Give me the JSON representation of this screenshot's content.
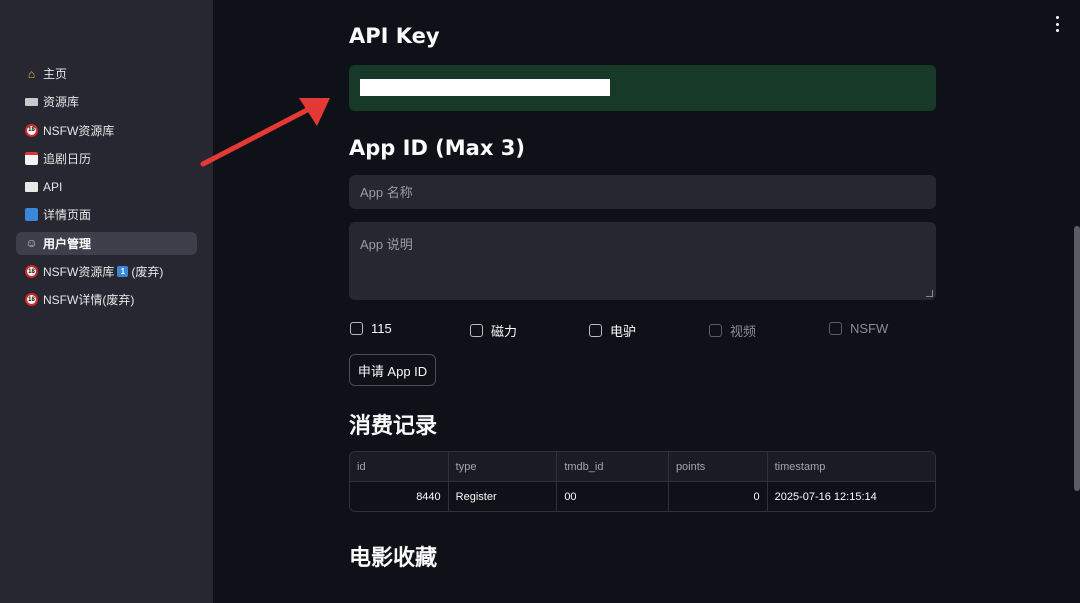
{
  "sidebar": {
    "items": [
      {
        "label": "主页",
        "icon": "house-icon",
        "active": false
      },
      {
        "label": "资源库",
        "icon": "keyboard-icon",
        "active": false
      },
      {
        "label": "NSFW资源库",
        "icon": "no-under-18-icon",
        "active": false
      },
      {
        "label": "追剧日历",
        "icon": "calendar-icon",
        "active": false
      },
      {
        "label": "API",
        "icon": "book-icon",
        "active": false
      },
      {
        "label": "详情页面",
        "icon": "grid-icon",
        "active": false
      },
      {
        "label": "用户管理",
        "icon": "user-icon",
        "active": true
      },
      {
        "label": "NSFW资源库",
        "suffix": "(废弃)",
        "badge": "1",
        "icon": "no-under-18-icon",
        "active": false
      },
      {
        "label": "NSFW详情(废弃)",
        "icon": "no-under-18-icon",
        "active": false
      }
    ]
  },
  "api_key": {
    "heading": "API Key",
    "value": ""
  },
  "app_id": {
    "heading": "App ID (Max 3)",
    "name_placeholder": "App 名称",
    "desc_placeholder": "App 说明",
    "checkboxes": [
      {
        "label": "115",
        "checked": false,
        "disabled": false
      },
      {
        "label": "磁力",
        "checked": false,
        "disabled": false
      },
      {
        "label": "电驴",
        "checked": false,
        "disabled": false
      },
      {
        "label": "视频",
        "checked": false,
        "disabled": true
      },
      {
        "label": "NSFW",
        "checked": false,
        "disabled": true
      }
    ],
    "apply_button": "申请 App ID"
  },
  "consumption": {
    "heading": "消费记录",
    "columns": [
      "id",
      "type",
      "tmdb_id",
      "points",
      "timestamp"
    ],
    "rows": [
      [
        "8440",
        "Register",
        "00",
        "0",
        "2025-07-16 12:15:14"
      ]
    ]
  },
  "favorites": {
    "heading": "电影收藏"
  },
  "colors": {
    "background": "#0e1117",
    "sidebar": "#262730",
    "api_key_box": "#173928",
    "arrow": "#e53935"
  }
}
